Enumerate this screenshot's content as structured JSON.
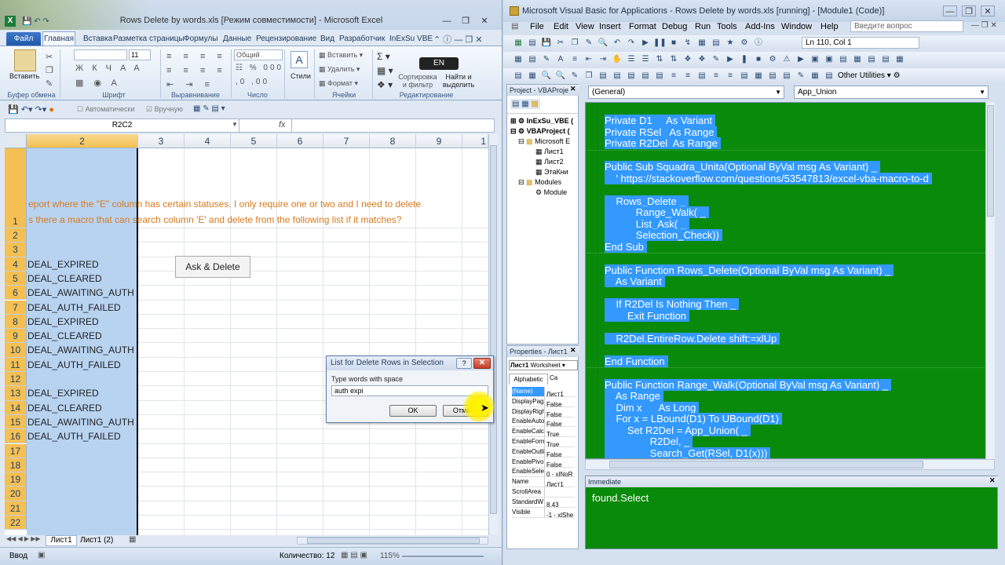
{
  "excel": {
    "title": "Rows Delete by words.xls  [Режим совместимости]  -  Microsoft Excel",
    "file_tab": "Файл",
    "tabs": [
      "Главная",
      "Вставка",
      "Разметка страницы",
      "Формулы",
      "Данные",
      "Рецензирование",
      "Вид",
      "Разработчик",
      "InExSu VBE"
    ],
    "ribbon": {
      "paste": "Вставить",
      "clipboard": "Буфер обмена",
      "font_size": "11",
      "font_group": "Шрифт",
      "align_group": "Выравнивание",
      "number_format": "Общий",
      "number_group": "Число",
      "styles": "Стили",
      "insert": "Вставить",
      "delete": "Удалить",
      "format": "Формат",
      "cells_group": "Ячейки",
      "sort": "Сортировка и фильтр",
      "find": "Найти и выделить",
      "edit_group": "Редактирование",
      "lang": "EN"
    },
    "qat": {
      "auto": "Автоматически",
      "manual": "Вручную"
    },
    "name_box": "R2C2",
    "fx": "fx",
    "col_headers": [
      "2",
      "3",
      "4",
      "5",
      "6",
      "7",
      "8",
      "9",
      "1"
    ],
    "overflow_text_1": "eport where the \"E\" column has certain statuses. I only require one or two and I need to delete",
    "overflow_text_2": "s there a macro that can search column 'E' and delete from the following list if it matches?",
    "rows": [
      {
        "n": "1",
        "v": ""
      },
      {
        "n": "2",
        "v": ""
      },
      {
        "n": "3",
        "v": ""
      },
      {
        "n": "4",
        "v": "DEAL_EXPIRED"
      },
      {
        "n": "5",
        "v": "DEAL_CLEARED"
      },
      {
        "n": "6",
        "v": "DEAL_AWAITING_AUTH"
      },
      {
        "n": "7",
        "v": "DEAL_AUTH_FAILED"
      },
      {
        "n": "8",
        "v": "DEAL_EXPIRED"
      },
      {
        "n": "9",
        "v": "DEAL_CLEARED"
      },
      {
        "n": "10",
        "v": "DEAL_AWAITING_AUTH"
      },
      {
        "n": "11",
        "v": "DEAL_AUTH_FAILED"
      },
      {
        "n": "12",
        "v": ""
      },
      {
        "n": "13",
        "v": "DEAL_EXPIRED"
      },
      {
        "n": "14",
        "v": "DEAL_CLEARED"
      },
      {
        "n": "15",
        "v": "DEAL_AWAITING_AUTH"
      },
      {
        "n": "16",
        "v": "DEAL_AUTH_FAILED"
      },
      {
        "n": "17",
        "v": ""
      },
      {
        "n": "18",
        "v": ""
      },
      {
        "n": "19",
        "v": ""
      },
      {
        "n": "20",
        "v": ""
      },
      {
        "n": "21",
        "v": ""
      },
      {
        "n": "22",
        "v": ""
      }
    ],
    "ask_button": "Ask & Delete",
    "sheets": [
      "Лист1",
      "Лист1 (2)"
    ],
    "status": {
      "mode": "Ввод",
      "count": "Количество: 12",
      "zoom": "115%"
    },
    "dialog": {
      "title": "List for Delete Rows in Selection",
      "help": "?",
      "label": "Type words with space",
      "value": "auth expi",
      "ok": "OK",
      "cancel": "Отмена"
    }
  },
  "vba": {
    "title": "Microsoft Visual Basic for Applications - Rows Delete by words.xls [running] - [Module1 (Code)]",
    "menus": [
      "File",
      "Edit",
      "View",
      "Insert",
      "Format",
      "Debug",
      "Run",
      "Tools",
      "Add-Ins",
      "Window",
      "Help"
    ],
    "search_placeholder": "Введите вопрос",
    "line_col": "Ln 110, Col 1",
    "other_utilities": "Other Utilities",
    "project_title": "Project - VBAProje",
    "tree": [
      "InExSu_VBE (",
      "VBAProject (",
      "Microsoft E",
      "Лист1",
      "Лист2",
      "ЭтаКни",
      "Modules",
      "Module"
    ],
    "props_title": "Properties - Лист1",
    "props_object": "Лист1",
    "props_type": "Worksheet",
    "props_tabs": [
      "Alphabetic",
      "Ca"
    ],
    "props": [
      {
        "k": "(Name)",
        "v": "Лист1"
      },
      {
        "k": "DisplayPag",
        "v": "False"
      },
      {
        "k": "DisplayRigh",
        "v": "False"
      },
      {
        "k": "EnableAuto",
        "v": "False"
      },
      {
        "k": "EnableCalc",
        "v": "True"
      },
      {
        "k": "EnableForm",
        "v": "True"
      },
      {
        "k": "EnableOutli",
        "v": "False"
      },
      {
        "k": "EnablePivo",
        "v": "False"
      },
      {
        "k": "EnableSele",
        "v": "0 - xlNoR"
      },
      {
        "k": "Name",
        "v": "Лист1"
      },
      {
        "k": "ScrollArea",
        "v": ""
      },
      {
        "k": "StandardW",
        "v": "8,43"
      },
      {
        "k": "Visible",
        "v": "-1 - xlShe"
      }
    ],
    "combo_left": "(General)",
    "combo_right": "App_Union",
    "code": [
      "Private D1     As Variant",
      "Private RSel   As Range",
      "Private R2Del  As Range",
      "",
      "Public Sub Squadra_Unita(Optional ByVal msg As Variant) _",
      "    ' https://stackoverflow.com/questions/53547813/excel-vba-macro-to-d",
      "",
      "    Rows_Delete _",
      "           Range_Walk( _",
      "           List_Ask( _",
      "           Selection_Check))",
      "End Sub",
      "",
      "Public Function Rows_Delete(Optional ByVal msg As Variant) _",
      "    As Variant",
      "",
      "    If R2Del Is Nothing Then _",
      "        Exit Function",
      "",
      "    R2Del.EntireRow.Delete shift:=xlUp",
      "",
      "End Function",
      "",
      "Public Function Range_Walk(Optional ByVal msg As Variant) _",
      "    As Range",
      "    Dim x      As Long",
      "    For x = LBound(D1) To UBound(D1)",
      "        Set R2Del = App_Union( _",
      "                R2Del, _",
      "                Search_Get(RSel, D1(x)))"
    ],
    "immediate_title": "Immediate",
    "immediate_text": "found.Select"
  },
  "colors": {
    "code_bg": "#0a8a0a",
    "selection": "#3399ff",
    "col_sel": "#b8d3f0"
  }
}
